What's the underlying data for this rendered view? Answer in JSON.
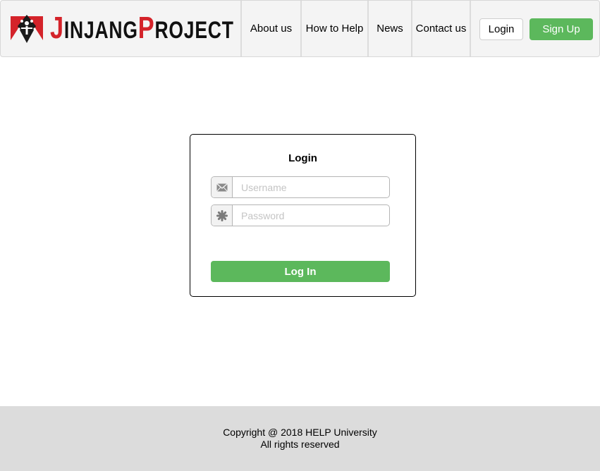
{
  "brand": {
    "letter_j": "J",
    "rest_1": "INJANG",
    "letter_p": "P",
    "rest_2": "ROJECT",
    "logo_icon": "tiger-emblem-icon"
  },
  "nav": {
    "items": [
      {
        "label": "About us"
      },
      {
        "label": "How to Help"
      },
      {
        "label": "News"
      },
      {
        "label": "Contact us"
      }
    ],
    "login_label": "Login",
    "signup_label": "Sign Up"
  },
  "login_form": {
    "title": "Login",
    "username": {
      "placeholder": "Username",
      "value": "",
      "icon": "envelope-icon"
    },
    "password": {
      "placeholder": "Password",
      "value": "",
      "icon": "asterisk-icon"
    },
    "submit_label": "Log In"
  },
  "footer": {
    "line1": "Copyright @ 2018 HELP University",
    "line2": "All rights reserved"
  },
  "colors": {
    "accent_green": "#5cb85c",
    "brand_red": "#d4232a",
    "navbar_bg": "#f4f4f4",
    "footer_bg": "#dcdcdc"
  }
}
